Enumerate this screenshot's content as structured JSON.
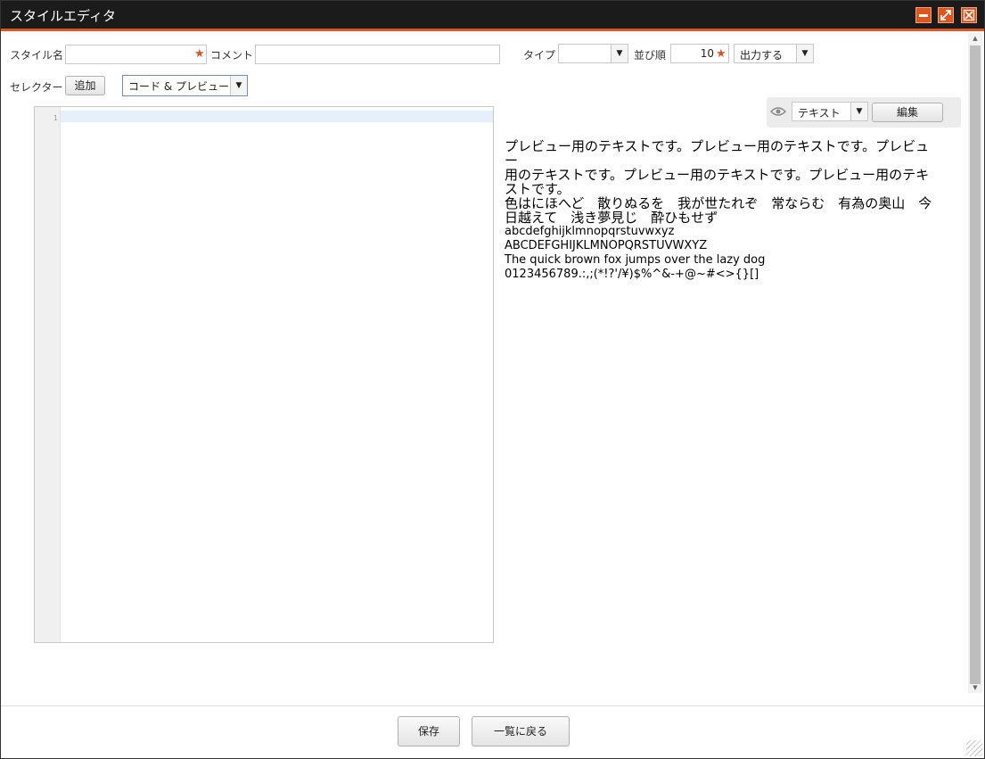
{
  "window": {
    "title": "スタイルエディタ",
    "accent_color": "#e0551e",
    "titlebar_color": "#1b1b1b"
  },
  "form": {
    "style_name_label": "スタイル名",
    "style_name_value": "",
    "comment_label": "コメント",
    "comment_value": "",
    "type_label": "タイプ",
    "type_value": "",
    "order_label": "並び順",
    "order_value": "10",
    "output_value": "出力する",
    "required_mark": "★",
    "selector_label": "セレクター",
    "add_button": "追加",
    "view_mode_value": "コード & プレビュー"
  },
  "editor": {
    "line_numbers": [
      "1"
    ]
  },
  "preview": {
    "mode_value": "テキスト",
    "edit_button": "編集",
    "eye_icon": "eye-icon",
    "lines_japanese": [
      "プレビュー用のテキストです。プレビュー用のテキストです。プレビュー",
      "用のテキストです。プレビュー用のテキストです。プレビュー用のテキ",
      "ストです。",
      "色はにほへど　散りぬるを　我が世たれぞ　常ならむ　有為の奥山　今",
      "日越えて　浅き夢見じ　酔ひもせず"
    ],
    "lines_ascii": [
      "abcdefghijklmnopqrstuvwxyz",
      "ABCDEFGHIJKLMNOPQRSTUVWXYZ",
      "The quick brown fox jumps over the lazy dog",
      "0123456789.:,;(*!?'/¥)$%^&-+@~#<>{}[]"
    ]
  },
  "footer": {
    "save_button": "保存",
    "back_button": "一覧に戻る"
  },
  "icons": {
    "minimize": "minimize-icon",
    "maximize": "maximize-icon",
    "close": "close-icon",
    "dropdown": "▼"
  }
}
